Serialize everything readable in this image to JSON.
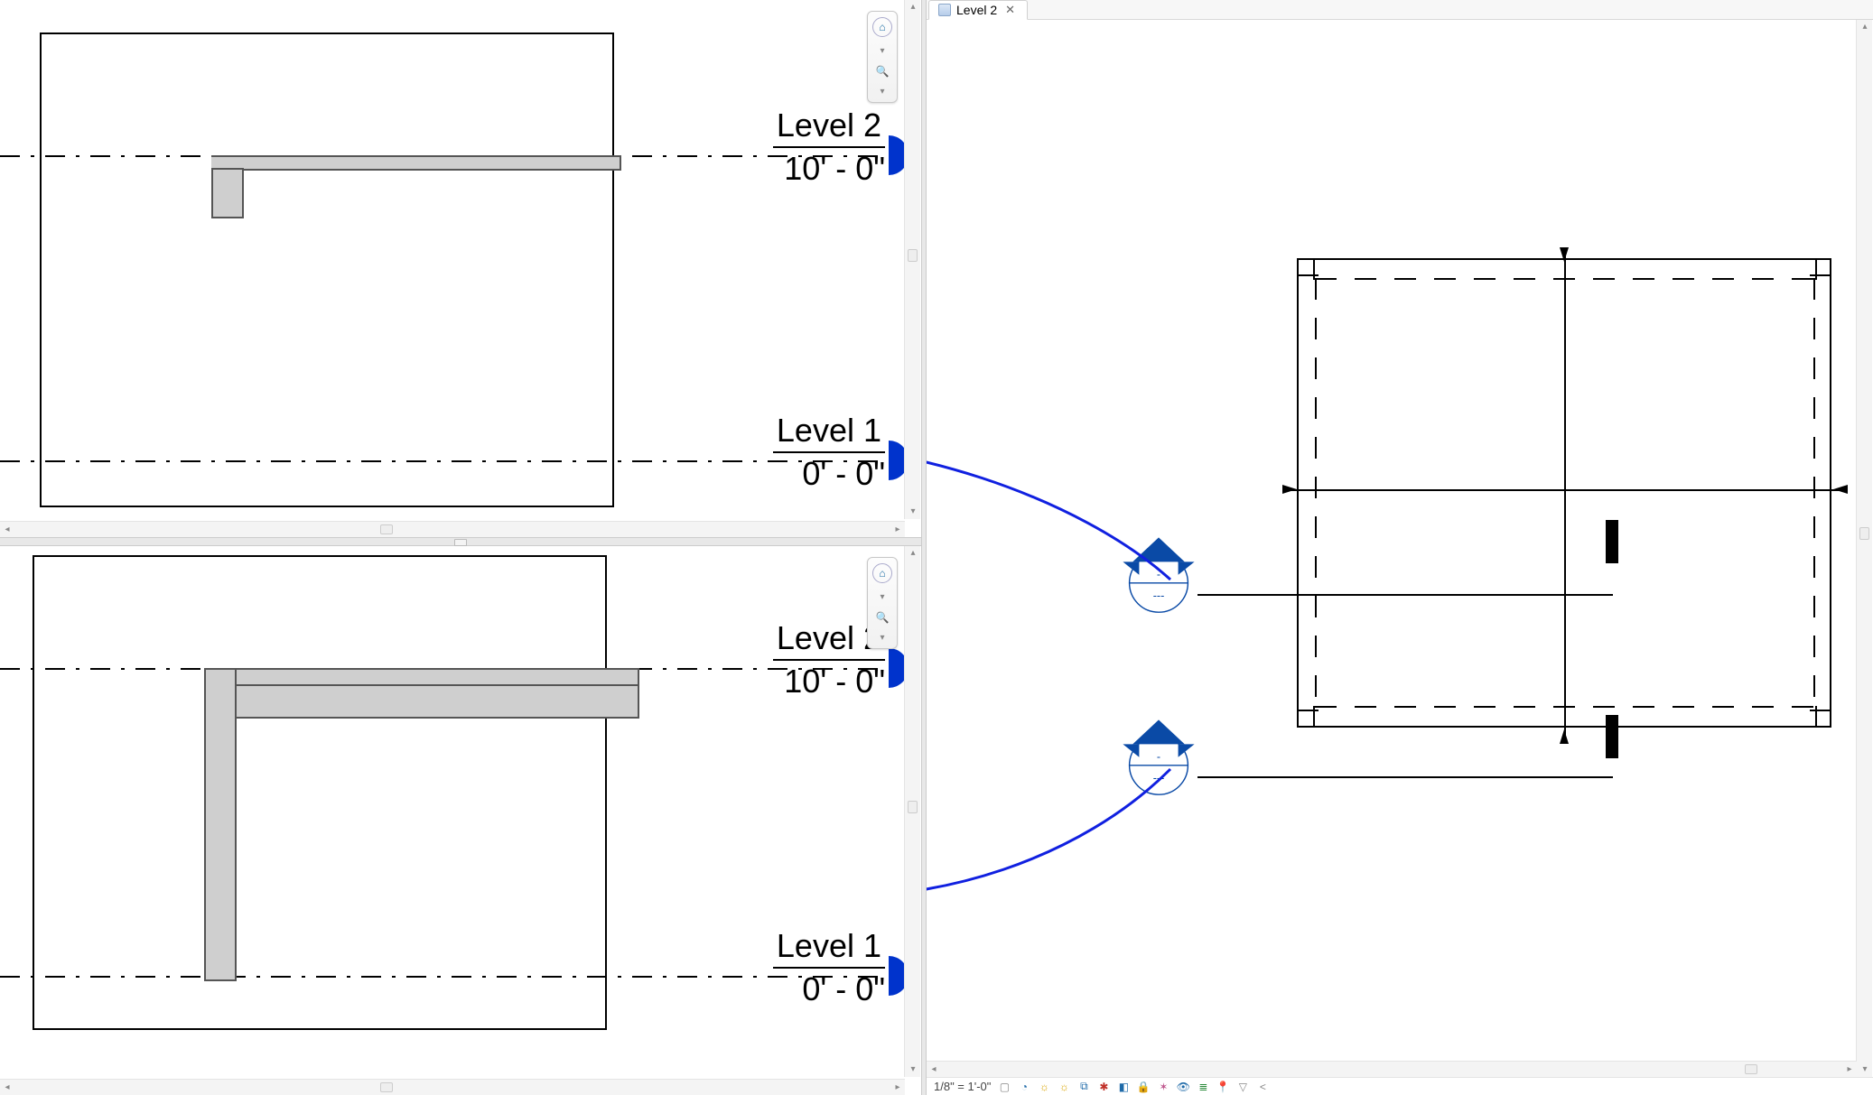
{
  "tabs": {
    "active": {
      "label": "Level 2"
    }
  },
  "levels": {
    "top": {
      "l2": {
        "name": "Level 2",
        "elev": "10' - 0\""
      },
      "l1": {
        "name": "Level 1",
        "elev": "0' - 0\""
      }
    },
    "bottom": {
      "l2": {
        "name": "Level 2",
        "elev": "10' - 0\""
      },
      "l1": {
        "name": "Level 1",
        "elev": "0' - 0\""
      }
    }
  },
  "section_marker": {
    "ref1": "-",
    "ref2": "---"
  },
  "status": {
    "scale": "1/8\" = 1'-0\""
  },
  "icons": {
    "home": "⌂",
    "zoom": "🔍",
    "caret": "▾",
    "close": "✕",
    "sb_square": "▢",
    "sb_pie": "◔",
    "sb_sun": "☼",
    "sb_crop": "⧉",
    "sb_puzzle": "✱",
    "sb_cube": "◧",
    "sb_bulb": "✶",
    "sb_filter": "▽",
    "sb_pin": "📍",
    "sb_eye": "👁",
    "sb_layers": "≣",
    "sb_lock": "🔒",
    "sb_ge": "<",
    "level_tick": "◗"
  }
}
